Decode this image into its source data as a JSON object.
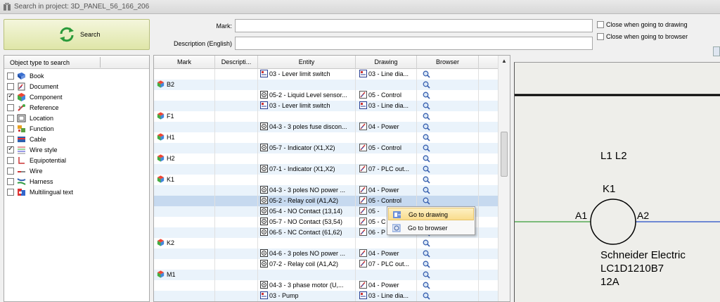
{
  "window": {
    "title": "Search in project: 3D_PANEL_56_166_206"
  },
  "search_button": {
    "label": "Search"
  },
  "fields": {
    "mark": {
      "label": "Mark:",
      "value": ""
    },
    "description": {
      "label": "Description (English)",
      "value": ""
    }
  },
  "options": [
    {
      "label": "Close when going to drawing",
      "checked": false
    },
    {
      "label": "Close when going to browser",
      "checked": false
    }
  ],
  "object_types": {
    "header": "Object type to search",
    "items": [
      {
        "label": "Book",
        "checked": false,
        "icon": "book-icon"
      },
      {
        "label": "Document",
        "checked": false,
        "icon": "document-icon"
      },
      {
        "label": "Component",
        "checked": true,
        "icon": "component-icon"
      },
      {
        "label": "Reference",
        "checked": false,
        "icon": "reference-icon"
      },
      {
        "label": "Location",
        "checked": false,
        "icon": "location-icon"
      },
      {
        "label": "Function",
        "checked": false,
        "icon": "function-icon"
      },
      {
        "label": "Cable",
        "checked": false,
        "icon": "cable-icon"
      },
      {
        "label": "Wire style",
        "checked": true,
        "icon": "wire-style-icon"
      },
      {
        "label": "Equipotential",
        "checked": false,
        "icon": "equipotential-icon"
      },
      {
        "label": "Wire",
        "checked": false,
        "icon": "wire-icon"
      },
      {
        "label": "Harness",
        "checked": false,
        "icon": "harness-icon"
      },
      {
        "label": "Multilingual text",
        "checked": false,
        "icon": "multilingual-text-icon"
      }
    ]
  },
  "results": {
    "columns": [
      "Mark",
      "Descripti...",
      "Entity",
      "Drawing",
      "Browser"
    ],
    "rows": [
      {
        "mark": "",
        "entity": "03 - Lever limit switch",
        "entity_icon": "drawing-doc",
        "drawing": "03 - Line dia...",
        "drawing_icon": "drawing-doc"
      },
      {
        "mark": "B2",
        "entity": "",
        "drawing": ""
      },
      {
        "mark": "",
        "entity": "05-2 - Liquid Level sensor...",
        "entity_icon": "symbol",
        "drawing": "05 - Control",
        "drawing_icon": "schematic"
      },
      {
        "mark": "",
        "entity": "03 - Lever limit switch",
        "entity_icon": "drawing-doc",
        "drawing": "03 - Line dia...",
        "drawing_icon": "drawing-doc"
      },
      {
        "mark": "F1",
        "entity": "",
        "drawing": ""
      },
      {
        "mark": "",
        "entity": "04-3 - 3 poles fuse discon...",
        "entity_icon": "symbol",
        "drawing": "04 - Power",
        "drawing_icon": "schematic"
      },
      {
        "mark": "H1",
        "entity": "",
        "drawing": ""
      },
      {
        "mark": "",
        "entity": "05-7 - Indicator (X1,X2)",
        "entity_icon": "symbol",
        "drawing": "05 - Control",
        "drawing_icon": "schematic"
      },
      {
        "mark": "H2",
        "entity": "",
        "drawing": ""
      },
      {
        "mark": "",
        "entity": "07-1 - Indicator (X1,X2)",
        "entity_icon": "symbol",
        "drawing": "07 - PLC out...",
        "drawing_icon": "schematic"
      },
      {
        "mark": "K1",
        "entity": "",
        "drawing": ""
      },
      {
        "mark": "",
        "entity": "04-3 - 3 poles NO power ...",
        "entity_icon": "symbol",
        "drawing": "04 - Power",
        "drawing_icon": "schematic"
      },
      {
        "mark": "",
        "entity": "05-2 - Relay coil (A1,A2)",
        "entity_icon": "symbol",
        "drawing": "05 - Control",
        "drawing_icon": "schematic",
        "selected": true
      },
      {
        "mark": "",
        "entity": "05-4 - NO Contact (13,14)",
        "entity_icon": "symbol",
        "drawing": "05 -",
        "drawing_icon": "schematic"
      },
      {
        "mark": "",
        "entity": "05-7 - NO Contact (53,54)",
        "entity_icon": "symbol",
        "drawing": "05 - C",
        "drawing_icon": "schematic"
      },
      {
        "mark": "",
        "entity": "06-5 - NC Contact (61,62)",
        "entity_icon": "symbol",
        "drawing": "06 - P",
        "drawing_icon": "schematic"
      },
      {
        "mark": "K2",
        "entity": "",
        "drawing": ""
      },
      {
        "mark": "",
        "entity": "04-6 - 3 poles NO power ...",
        "entity_icon": "symbol",
        "drawing": "04 - Power",
        "drawing_icon": "schematic"
      },
      {
        "mark": "",
        "entity": "07-2 - Relay coil (A1,A2)",
        "entity_icon": "symbol",
        "drawing": "07 - PLC out...",
        "drawing_icon": "schematic"
      },
      {
        "mark": "M1",
        "entity": "",
        "drawing": ""
      },
      {
        "mark": "",
        "entity": "04-3 - 3 phase motor (U,...",
        "entity_icon": "symbol",
        "drawing": "04 - Power",
        "drawing_icon": "schematic"
      },
      {
        "mark": "",
        "entity": "03 - Pump",
        "entity_icon": "drawing-doc",
        "drawing": "03 - Line dia...",
        "drawing_icon": "drawing-doc"
      }
    ]
  },
  "context_menu": {
    "items": [
      {
        "label": "Go to drawing",
        "icon": "go-to-drawing-icon",
        "highlighted": true
      },
      {
        "label": "Go to browser",
        "icon": "go-to-browser-icon",
        "highlighted": false
      }
    ]
  },
  "preview": {
    "labels": {
      "phases": "L1 L2",
      "mark": "K1",
      "pin_left": "A1",
      "pin_right": "A2",
      "manufacturer": "Schneider Electric",
      "reference": "LC1D1210B7",
      "rating": "12A"
    },
    "colors": {
      "wire_left": "#55aa55",
      "wire_right": "#4466cc",
      "bus": "#000000"
    }
  },
  "colors": {
    "selection": "#c6d9ef",
    "row_alt": "#eaf3fb",
    "menu_highlight": "#f9dc8c"
  }
}
